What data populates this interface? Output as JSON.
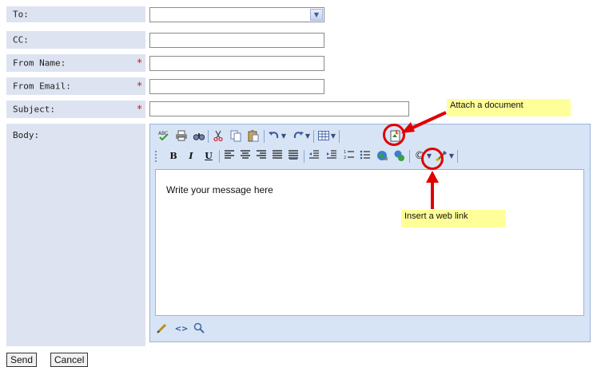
{
  "form": {
    "to": {
      "label": "To:",
      "value": ""
    },
    "cc": {
      "label": "CC:",
      "value": ""
    },
    "from_name": {
      "label": "From Name:",
      "value": "",
      "required_mark": "*"
    },
    "from_email": {
      "label": "From Email:",
      "value": "",
      "required_mark": "*"
    },
    "subject": {
      "label": "Subject:",
      "value": "",
      "required_mark": "*"
    },
    "body": {
      "label": "Body:"
    }
  },
  "editor": {
    "toolbar1": [
      "spellcheck-icon",
      "print-icon",
      "find-icon",
      "cut-icon",
      "copy-icon",
      "paste-icon",
      "undo-icon",
      "redo-icon",
      "table-icon",
      "attach-document-icon"
    ],
    "toolbar2": [
      "bold-icon",
      "italic-icon",
      "underline-icon",
      "align-left-icon",
      "align-center-icon",
      "align-right-icon",
      "justify-icon",
      "justify-full-icon",
      "outdent-icon",
      "indent-icon",
      "numbered-list-icon",
      "bulleted-list-icon",
      "insert-link-icon",
      "remove-link-icon",
      "special-char-icon",
      "format-brush-icon"
    ],
    "bold_glyph": "B",
    "italic_glyph": "I",
    "underline_glyph": "U",
    "content": "Write your message here",
    "footer_icons": [
      "pencil-design-icon",
      "html-source-icon",
      "preview-magnifier-icon"
    ]
  },
  "annotations": {
    "attach": "Attach a document",
    "link": "Insert a web link",
    "arrow_color": "#e00000",
    "callout_color": "#ffff99"
  },
  "buttons": {
    "send": "Send",
    "cancel": "Cancel"
  },
  "colors": {
    "label_bg": "#dde3f0",
    "required": "#d01010",
    "editor_bg": "#d7e4f6"
  }
}
